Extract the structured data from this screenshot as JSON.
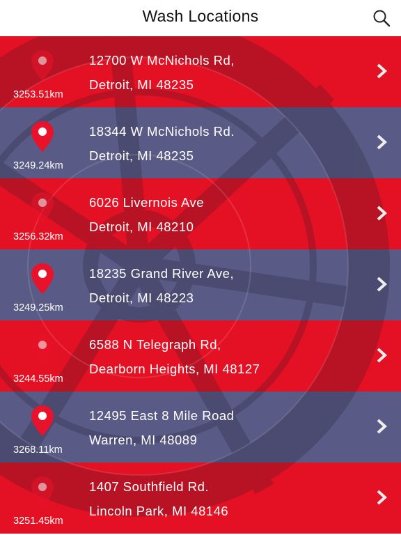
{
  "header": {
    "title": "Wash Locations",
    "search_icon": "search-icon"
  },
  "colors": {
    "red_row": "#e41124",
    "slate_row": "#5a5a86",
    "pin_red": "#e8122a"
  },
  "locations": [
    {
      "line1": "12700 W McNichols Rd,",
      "line2": "Detroit, MI 48235",
      "distance": "3253.51km",
      "row_color": "red"
    },
    {
      "line1": "18344 W McNichols Rd.",
      "line2": "Detroit, MI 48235",
      "distance": "3249.24km",
      "row_color": "slate"
    },
    {
      "line1": "6026 Livernois Ave",
      "line2": "Detroit, MI 48210",
      "distance": "3256.32km",
      "row_color": "red"
    },
    {
      "line1": "18235 Grand River Ave,",
      "line2": "Detroit, MI 48223",
      "distance": "3249.25km",
      "row_color": "slate"
    },
    {
      "line1": "6588 N Telegraph Rd,",
      "line2": "Dearborn Heights, MI 48127",
      "distance": "3244.55km",
      "row_color": "red"
    },
    {
      "line1": "12495 East 8 Mile Road",
      "line2": "Warren, MI 48089",
      "distance": "3268.11km",
      "row_color": "slate"
    },
    {
      "line1": "1407 Southfield Rd.",
      "line2": "Lincoln Park, MI 48146",
      "distance": "3251.45km",
      "row_color": "red"
    }
  ]
}
